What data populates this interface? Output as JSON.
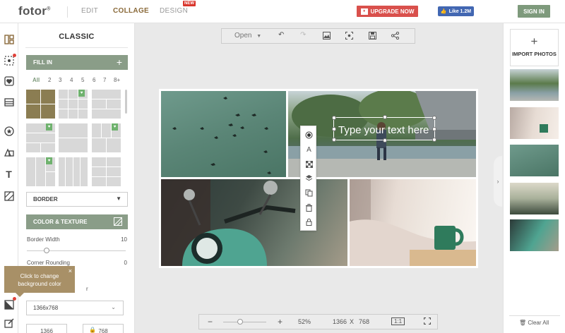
{
  "header": {
    "logo": "fotor",
    "logo_mark": "®",
    "nav": [
      {
        "label": "EDIT"
      },
      {
        "label": "COLLAGE"
      },
      {
        "label": "DESIGN"
      }
    ],
    "new_badge": "NEW",
    "upgrade_label": "UPGRADE NOW",
    "fb_like_label": "Like 1.2M",
    "signin_label": "SIGN IN"
  },
  "rail": {
    "icons": [
      "layout-icon",
      "magic-icon",
      "sticker-icon",
      "template-icon",
      "star-icon",
      "shapes-icon",
      "text-icon",
      "pattern-icon",
      "background-icon",
      "edit-icon"
    ]
  },
  "panel": {
    "title": "CLASSIC",
    "fill_in_label": "FILL IN",
    "filters": [
      "All",
      "2",
      "3",
      "4",
      "5",
      "6",
      "7",
      "8+"
    ],
    "border_label": "BORDER",
    "color_texture_label": "COLOR & TEXTURE",
    "border_width_label": "Border Width",
    "border_width_value": "10",
    "border_width_fraction": 0.2,
    "corner_rounding_label": "Corner Rounding",
    "corner_rounding_value": "0",
    "partial_label": "r",
    "size_select_value": "1366x768",
    "width_value": "1366",
    "height_value": "768"
  },
  "tooltip": {
    "text_line1": "Click to change",
    "text_line2": "background color",
    "close": "×"
  },
  "toolbar": {
    "open_label": "Open"
  },
  "canvas": {
    "text_placeholder": "Type your text here"
  },
  "zoombar": {
    "minus": "−",
    "plus": "+",
    "zoom_label": "52%",
    "zoom_fraction": 0.4,
    "width": "1366",
    "x": "X",
    "height": "768",
    "ratio_label": "1:1"
  },
  "right_panel": {
    "import_label": "IMPORT PHOTOS",
    "clear_all_label": "Clear All"
  },
  "colors": {
    "accent_green": "#7e9a7c",
    "collage_active": "#8a6a3a",
    "upgrade_red": "#d9504c",
    "facebook_blue": "#4267b2",
    "tooltip_gold": "#a89067"
  }
}
